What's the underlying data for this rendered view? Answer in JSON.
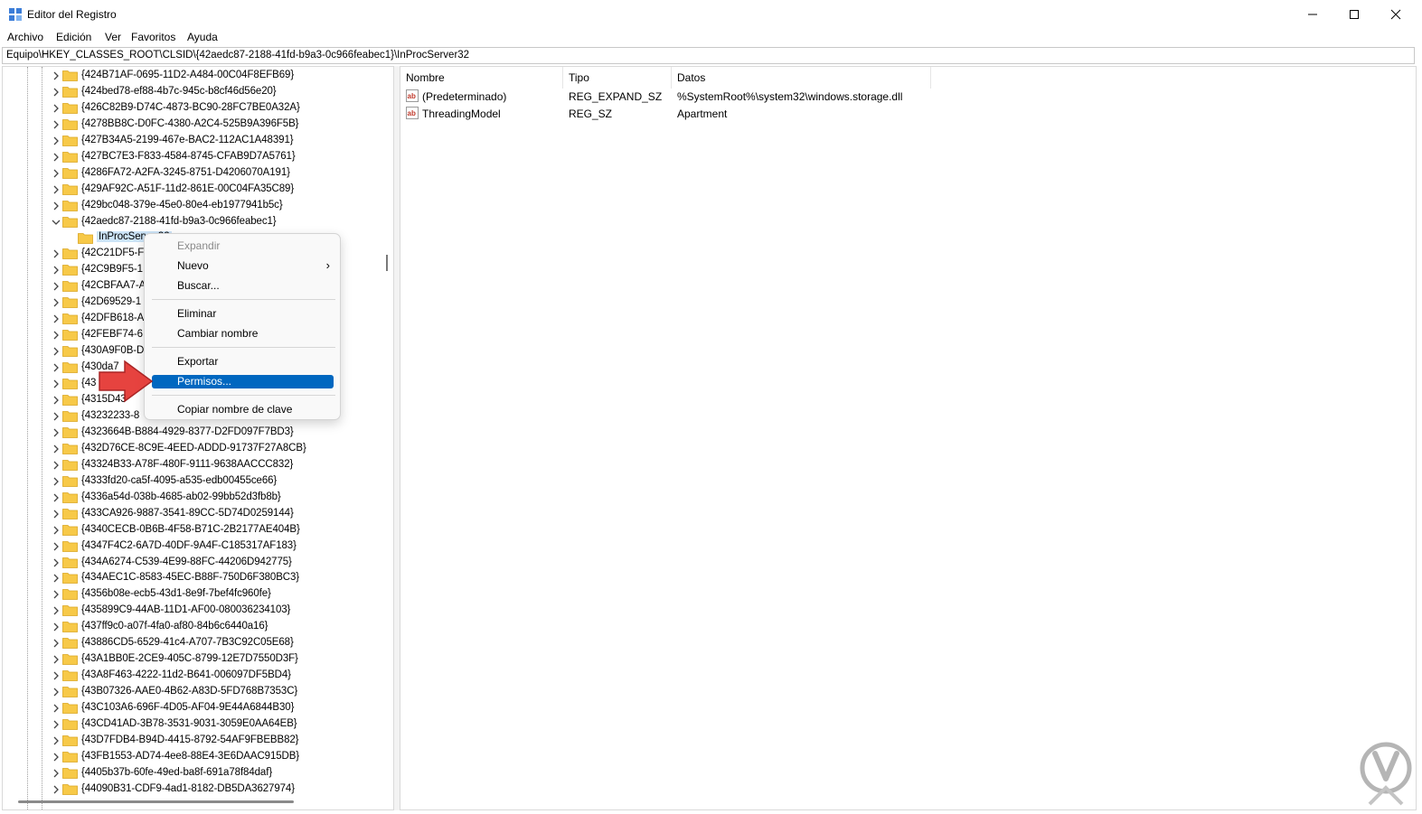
{
  "window": {
    "title": "Editor del Registro",
    "controls": {
      "minimize": "—",
      "maximize": "☐",
      "close": "✕"
    }
  },
  "menubar": [
    "Archivo",
    "Edición",
    "Ver",
    "Favoritos",
    "Ayuda"
  ],
  "address": "Equipo\\HKEY_CLASSES_ROOT\\CLSID\\{42aedc87-2188-41fd-b9a3-0c966feabec1}\\InProcServer32",
  "tree": {
    "rows": [
      {
        "label": "{424B71AF-0695-11D2-A484-00C04F8EFB69}"
      },
      {
        "label": "{424bed78-ef88-4b7c-945c-b8cf46d56e20}"
      },
      {
        "label": "{426C82B9-D74C-4873-BC90-28FC7BE0A32A}"
      },
      {
        "label": "{4278BB8C-D0FC-4380-A2C4-525B9A396F5B}"
      },
      {
        "label": "{427B34A5-2199-467e-BAC2-112AC1A48391}"
      },
      {
        "label": "{427BC7E3-F833-4584-8745-CFAB9D7A5761}"
      },
      {
        "label": "{4286FA72-A2FA-3245-8751-D4206070A191}"
      },
      {
        "label": "{429AF92C-A51F-11d2-861E-00C04FA35C89}"
      },
      {
        "label": "{429bc048-379e-45e0-80e4-eb1977941b5c}"
      },
      {
        "label": "{42aedc87-2188-41fd-b9a3-0c966feabec1}"
      },
      {
        "label": "InProcServer32"
      },
      {
        "label": "{42C21DF5-F"
      },
      {
        "label": "{42C9B9F5-1"
      },
      {
        "label": "{42CBFAA7-A"
      },
      {
        "label": "{42D69529-1"
      },
      {
        "label": "{42DFB618-A"
      },
      {
        "label": "{42FEBF74-6"
      },
      {
        "label": "{430A9F0B-D"
      },
      {
        "label": "{430da7"
      },
      {
        "label": "{43"
      },
      {
        "label": "{4315D43"
      },
      {
        "label": "{43232233-8"
      },
      {
        "label": "{4323664B-B884-4929-8377-D2FD097F7BD3}"
      },
      {
        "label": "{432D76CE-8C9E-4EED-ADDD-91737F27A8CB}"
      },
      {
        "label": "{43324B33-A78F-480F-9111-9638AACCC832}"
      },
      {
        "label": "{4333fd20-ca5f-4095-a535-edb00455ce66}"
      },
      {
        "label": "{4336a54d-038b-4685-ab02-99bb52d3fb8b}"
      },
      {
        "label": "{433CA926-9887-3541-89CC-5D74D0259144}"
      },
      {
        "label": "{4340CECB-0B6B-4F58-B71C-2B2177AE404B}"
      },
      {
        "label": "{4347F4C2-6A7D-40DF-9A4F-C185317AF183}"
      },
      {
        "label": "{434A6274-C539-4E99-88FC-44206D942775}"
      },
      {
        "label": "{434AEC1C-8583-45EC-B88F-750D6F380BC3}"
      },
      {
        "label": "{4356b08e-ecb5-43d1-8e9f-7bef4fc960fe}"
      },
      {
        "label": "{435899C9-44AB-11D1-AF00-080036234103}"
      },
      {
        "label": "{437ff9c0-a07f-4fa0-af80-84b6c6440a16}"
      },
      {
        "label": "{43886CD5-6529-41c4-A707-7B3C92C05E68}"
      },
      {
        "label": "{43A1BB0E-2CE9-405C-8799-12E7D7550D3F}"
      },
      {
        "label": "{43A8F463-4222-11d2-B641-006097DF5BD4}"
      },
      {
        "label": "{43B07326-AAE0-4B62-A83D-5FD768B7353C}"
      },
      {
        "label": "{43C103A6-696F-4D05-AF04-9E44A6844B30}"
      },
      {
        "label": "{43CD41AD-3B78-3531-9031-3059E0AA64EB}"
      },
      {
        "label": "{43D7FDB4-B94D-4415-8792-54AF9FBEBB82}"
      },
      {
        "label": "{43FB1553-AD74-4ee8-88E4-3E6DAAC915DB}"
      },
      {
        "label": "{4405b37b-60fe-49ed-ba8f-691a78f84daf}"
      },
      {
        "label": "{44090B31-CDF9-4ad1-8182-DB5DA3627974}"
      }
    ]
  },
  "values": {
    "columns": [
      "Nombre",
      "Tipo",
      "Datos"
    ],
    "rows": [
      {
        "name": "(Predeterminado)",
        "type": "REG_EXPAND_SZ",
        "data": "%SystemRoot%\\system32\\windows.storage.dll"
      },
      {
        "name": "ThreadingModel",
        "type": "REG_SZ",
        "data": "Apartment"
      }
    ]
  },
  "context_menu": {
    "items": [
      {
        "label": "Expandir",
        "disabled": true
      },
      {
        "label": "Nuevo",
        "submenu": true
      },
      {
        "label": "Buscar..."
      },
      {
        "label": "Eliminar"
      },
      {
        "label": "Cambiar nombre"
      },
      {
        "label": "Exportar"
      },
      {
        "label": "Permisos...",
        "selected": true
      },
      {
        "label": "Copiar nombre de clave"
      }
    ],
    "submenu_glyph": "›"
  },
  "colors": {
    "accent": "#0067c0",
    "folder": "#f7c948",
    "arrow": "#e53935",
    "value_icon": "#c0392b"
  }
}
